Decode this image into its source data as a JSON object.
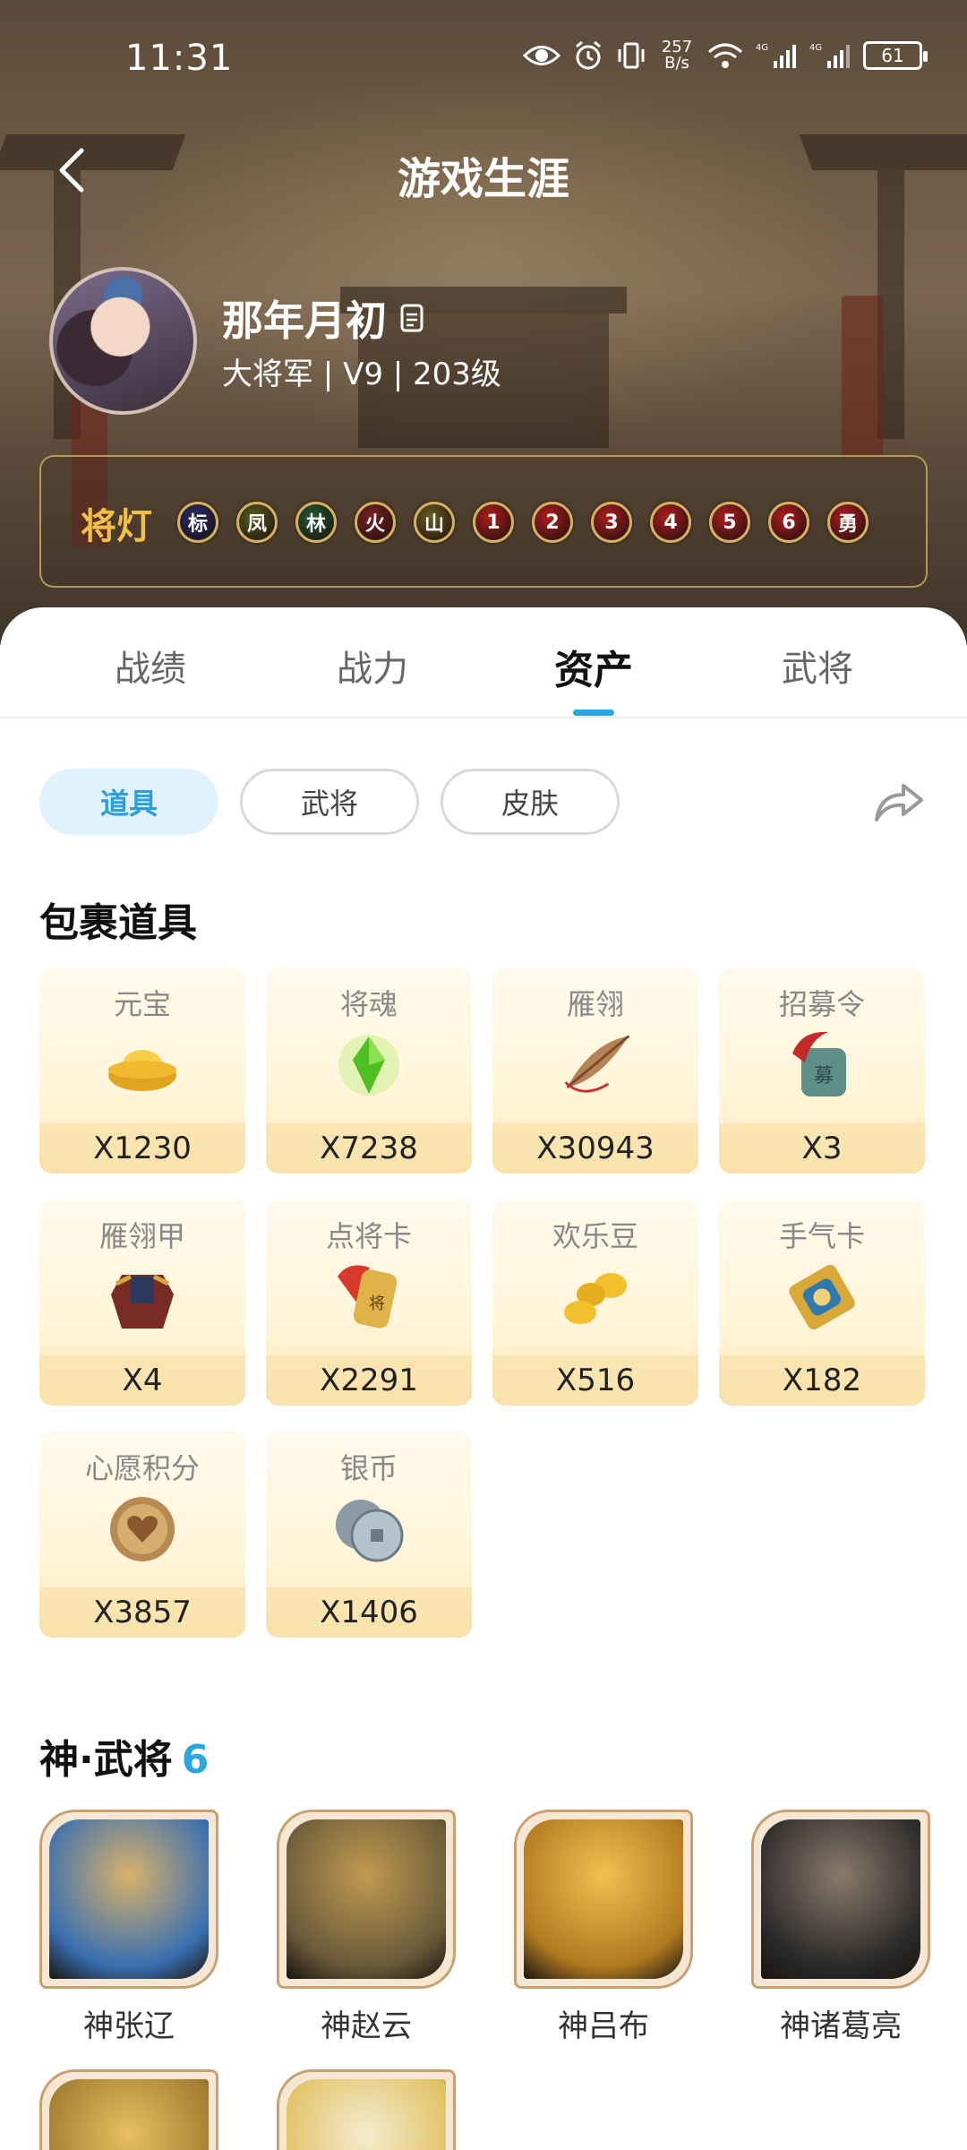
{
  "status": {
    "time": "11:31",
    "speed": "257\nB/s",
    "battery": "61",
    "net1": "4G",
    "net2": "4G"
  },
  "header": {
    "title": "游戏生涯"
  },
  "profile": {
    "name": "那年月初",
    "subtitle": "大将军 | V9 | 203级"
  },
  "lamps": {
    "title": "将灯",
    "items": [
      {
        "label": "标",
        "color": "#2a2a6a"
      },
      {
        "label": "凤",
        "color": "#5a5a20"
      },
      {
        "label": "林",
        "color": "#1f5a30"
      },
      {
        "label": "火",
        "color": "#7a2020"
      },
      {
        "label": "山",
        "color": "#6a5a20"
      },
      {
        "label": "1",
        "color": "#b01c1c"
      },
      {
        "label": "2",
        "color": "#b01c1c"
      },
      {
        "label": "3",
        "color": "#b01c1c"
      },
      {
        "label": "4",
        "color": "#b01c1c"
      },
      {
        "label": "5",
        "color": "#b01c1c"
      },
      {
        "label": "6",
        "color": "#b01c1c"
      },
      {
        "label": "勇",
        "color": "#b01c1c"
      }
    ]
  },
  "tabs": [
    "战绩",
    "战力",
    "资产",
    "武将"
  ],
  "active_tab": "资产",
  "chips": [
    "道具",
    "武将",
    "皮肤"
  ],
  "items_section": {
    "title": "包裹道具",
    "items": [
      {
        "name": "元宝",
        "count": "X1230",
        "icon": "gold-ingot-icon"
      },
      {
        "name": "将魂",
        "count": "X7238",
        "icon": "green-crystal-icon"
      },
      {
        "name": "雁翎",
        "count": "X30943",
        "icon": "feather-icon"
      },
      {
        "name": "招募令",
        "count": "X3",
        "icon": "recruit-token-icon"
      },
      {
        "name": "雁翎甲",
        "count": "X4",
        "icon": "armor-icon"
      },
      {
        "name": "点将卡",
        "count": "X2291",
        "icon": "general-card-icon"
      },
      {
        "name": "欢乐豆",
        "count": "X516",
        "icon": "beans-icon"
      },
      {
        "name": "手气卡",
        "count": "X182",
        "icon": "luck-card-icon"
      },
      {
        "name": "心愿积分",
        "count": "X3857",
        "icon": "heart-coin-icon"
      },
      {
        "name": "银币",
        "count": "X1406",
        "icon": "silver-coin-icon"
      }
    ]
  },
  "heroes_section": {
    "title": "神·武将",
    "count": "6",
    "heroes": [
      {
        "name": "神张辽",
        "color1": "#3a6fb0",
        "color2": "#d8b26a"
      },
      {
        "name": "神赵云",
        "color1": "#6a5a3a",
        "color2": "#c09a50"
      },
      {
        "name": "神吕布",
        "color1": "#b07a20",
        "color2": "#f0c050"
      },
      {
        "name": "神诸葛亮",
        "color1": "#2a2a2a",
        "color2": "#8a7a6a"
      },
      {
        "name": "",
        "color1": "#a07a30",
        "color2": "#e8c060"
      },
      {
        "name": "",
        "color1": "#e0c060",
        "color2": "#f4ecd0"
      }
    ]
  }
}
